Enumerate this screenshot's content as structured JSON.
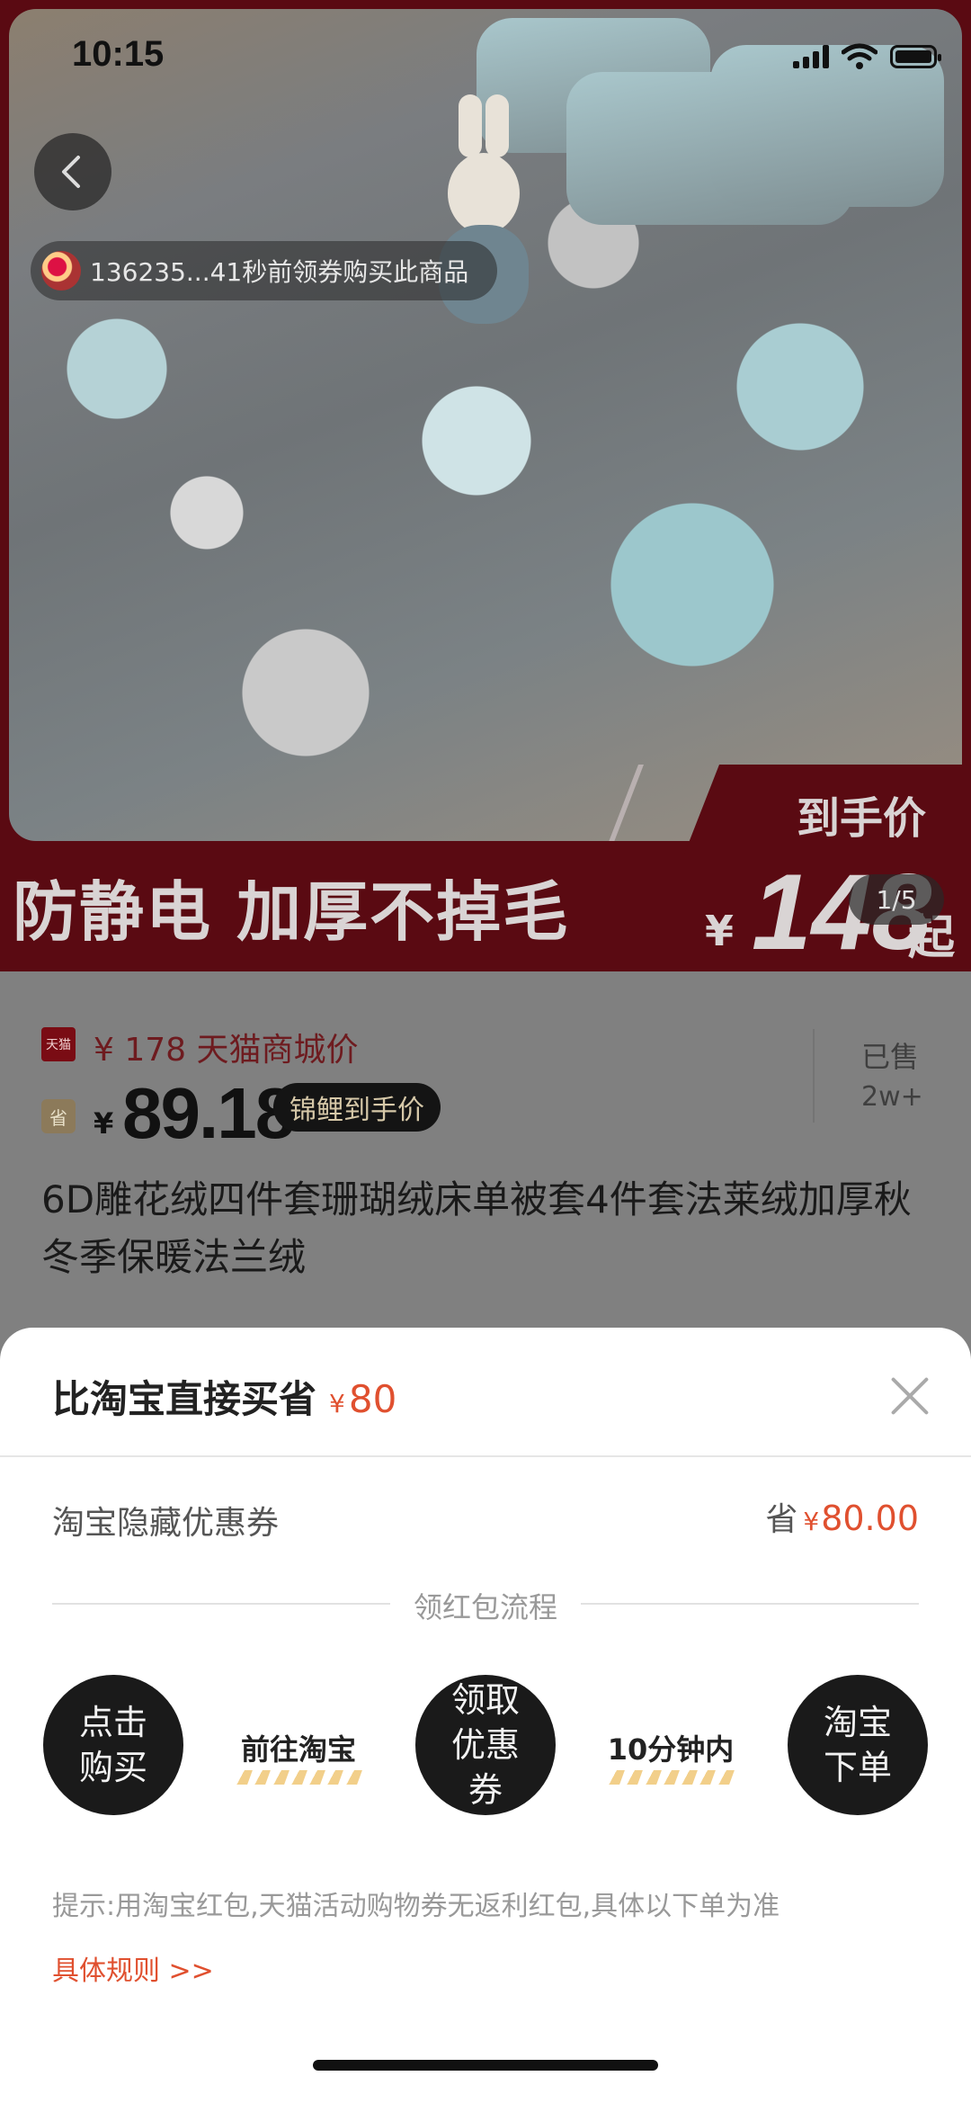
{
  "status_bar": {
    "time": "10:15"
  },
  "hero": {
    "ticker_text": "136235...41秒前领券购买此商品",
    "banner_left": "防静电  加厚不掉毛",
    "banner_label": "到手价",
    "banner_yen": "¥",
    "banner_price": "148",
    "banner_suffix": "起",
    "pager": "1/5"
  },
  "price": {
    "tmall_badge": "天猫",
    "original_price": "¥ 178 天猫商城价",
    "deal_badge": "省",
    "deal_currency": "¥",
    "deal_price": "89.18",
    "deal_tag": "锦鲤到手价",
    "sold_label": "已售",
    "sold_value": "2w+"
  },
  "product": {
    "title": "6D雕花绒四件套珊瑚绒床单被套4件套法莱绒加厚秋冬季保暖法兰绒"
  },
  "sheet": {
    "title": "比淘宝直接买省",
    "title_currency": "¥",
    "title_amount": "80",
    "coupon_label": "淘宝隐藏优惠券",
    "coupon_save_prefix": "省",
    "coupon_currency": "¥",
    "coupon_amount": "80.00",
    "flow_title": "领红包流程",
    "steps": [
      {
        "label": "点击购买"
      },
      {
        "label": "领取优惠券"
      },
      {
        "label": "淘宝下单"
      }
    ],
    "connectors": [
      {
        "label": "前往淘宝"
      },
      {
        "label": "10分钟内"
      }
    ],
    "hint": "提示:用淘宝红包,天猫活动购物券无返利红包,具体以下单为准",
    "rules_link": "具体规则 >>"
  },
  "colors": {
    "accent": "#e0502f",
    "banner_red": "#5a0a12",
    "step_circle": "#1a1a1a"
  }
}
